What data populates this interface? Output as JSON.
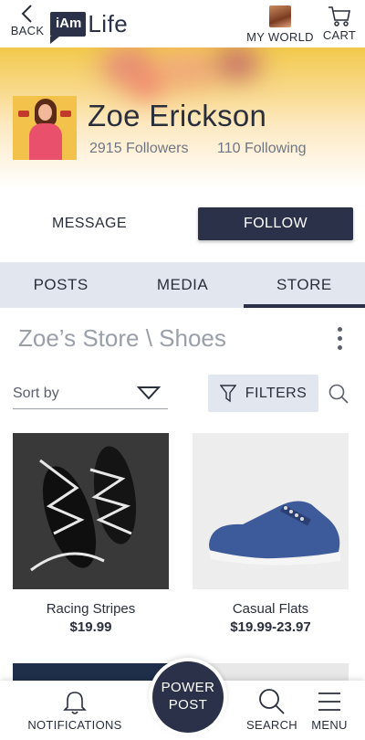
{
  "topbar": {
    "back_label": "BACK",
    "logo_badge": "iAm",
    "logo_word": "Life",
    "myworld_label": "MY WORLD",
    "cart_label": "CART"
  },
  "profile": {
    "name": "Zoe Erickson",
    "followers": "2915 Followers",
    "following": "110 Following"
  },
  "actions": {
    "message_label": "MESSAGE",
    "follow_label": "FOLLOW"
  },
  "tabs": [
    {
      "label": "POSTS",
      "active": false
    },
    {
      "label": "MEDIA",
      "active": false
    },
    {
      "label": "STORE",
      "active": true
    }
  ],
  "store": {
    "breadcrumb": "Zoe’s Store  \\  Shoes",
    "sort_label": "Sort by",
    "filters_label": "FILTERS"
  },
  "products": [
    {
      "name": "Racing Stripes",
      "price": "$19.99"
    },
    {
      "name": "Casual Flats",
      "price": "$19.99-23.97"
    }
  ],
  "bottomnav": {
    "notifications_label": "NOTIFICATIONS",
    "power_line1": "POWER",
    "power_line2": "POST",
    "search_label": "SEARCH",
    "menu_label": "MENU"
  },
  "colors": {
    "brand_navy": "#2b3148",
    "tab_bg": "#e2e6ee",
    "muted_text": "#707684"
  },
  "icons": [
    "chevron-left-icon",
    "cart-icon",
    "kebab-icon",
    "chevron-down-icon",
    "filter-icon",
    "search-icon",
    "bell-icon",
    "menu-icon"
  ]
}
